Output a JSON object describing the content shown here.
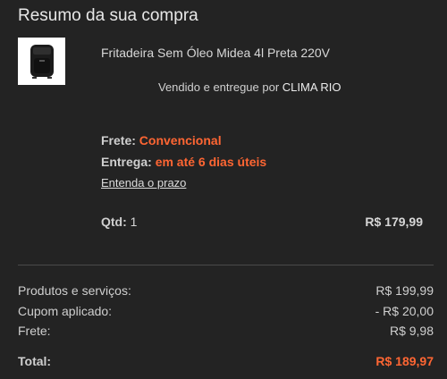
{
  "summary": {
    "title": "Resumo da sua compra"
  },
  "item": {
    "name": "Fritadeira Sem Óleo Midea 4l Preta 220V",
    "seller_prefix": "Vendido e entregue por",
    "seller_name": "CLIMA RIO",
    "image_icon": "air-fryer-product-image"
  },
  "shipping": {
    "frete_label": "Frete:",
    "frete_value": "Convencional",
    "entrega_label": "Entrega:",
    "entrega_value": "em até 6 dias úteis",
    "prazo_link": "Entenda o prazo"
  },
  "quantity": {
    "label": "Qtd:",
    "value": "1",
    "line_price": "R$ 179,99"
  },
  "totals": {
    "rows": [
      {
        "label": "Produtos e serviços:",
        "value": "R$ 199,99"
      },
      {
        "label": "Cupom aplicado:",
        "value": "- R$ 20,00"
      },
      {
        "label": "Frete:",
        "value": "R$ 9,98"
      }
    ],
    "total_label": "Total:",
    "total_value": "R$ 189,97"
  },
  "colors": {
    "background": "#232323",
    "accent": "#ff6633"
  }
}
